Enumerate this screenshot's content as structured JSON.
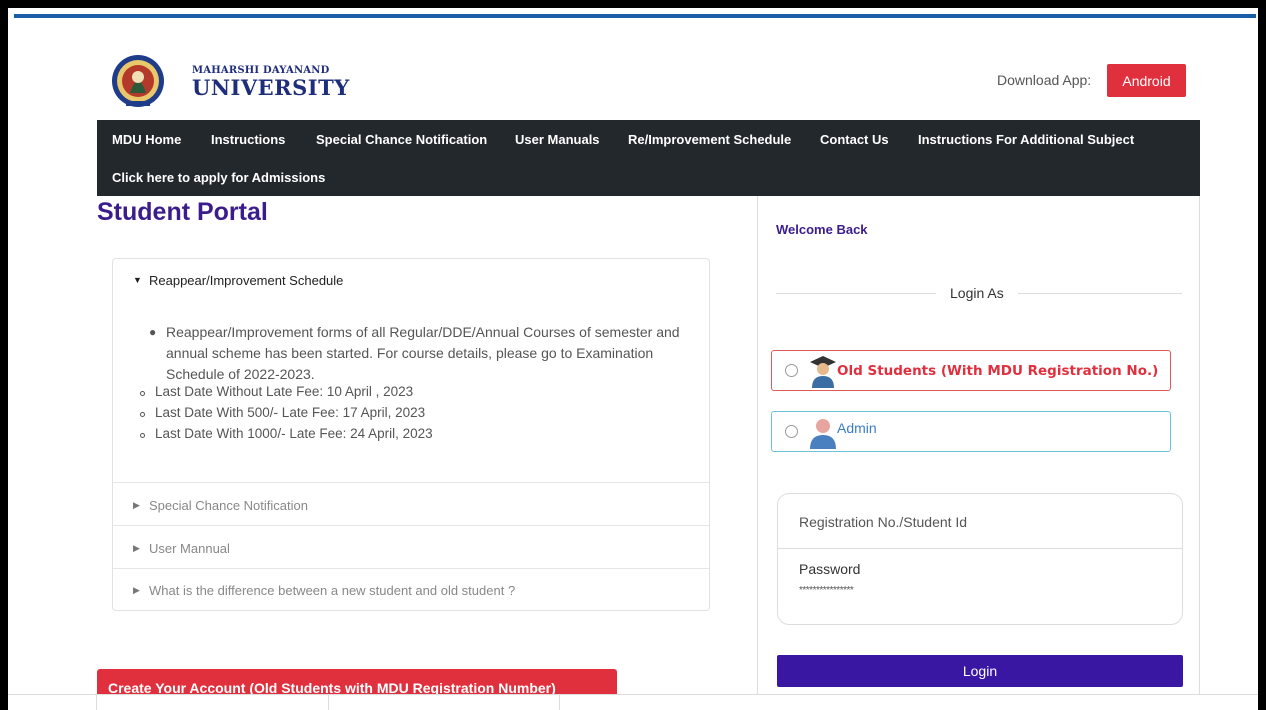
{
  "header": {
    "brand_line1": "MAHARSHI DAYANAND",
    "brand_line2": "UNIVERSITY",
    "download_label": "Download App:",
    "android_label": "Android"
  },
  "nav": {
    "items": [
      "MDU Home",
      "Instructions",
      "Special Chance Notification",
      "User Manuals",
      "Re/Improvement Schedule",
      "Contact Us",
      "Instructions For Additional Subject"
    ],
    "admissions": "Click here to apply for Admissions"
  },
  "portal": {
    "title": "Student Portal",
    "accordion": {
      "open_title": "Reappear/Improvement Schedule",
      "main_text": "Reappear/Improvement forms of all Regular/DDE/Annual Courses of semester and annual scheme has been started. For course details, please go to Examination Schedule of 2022-2023.",
      "dates": [
        "Last Date Without Late Fee: 10 April , 2023",
        "Last Date With 500/- Late Fee: 17 April, 2023",
        "Last Date With 1000/- Late Fee: 24 April, 2023"
      ],
      "collapsed": [
        "Special Chance Notification",
        "User Mannual",
        "What is the difference between a new student and old student ?"
      ]
    },
    "create_account": "Create Your Account (Old Students with MDU Registration Number)"
  },
  "login": {
    "welcome": "Welcome Back",
    "login_as": "Login As",
    "role_old": "Old Students (With MDU Registration No.)",
    "role_admin": "Admin",
    "reg_placeholder": "Registration No./Student Id",
    "password_label": "Password",
    "password_value": "****************",
    "login_button": "Login"
  },
  "colors": {
    "nav_bg": "#23282d",
    "accent_red": "#e0303e",
    "brand_purple": "#3b1c8c",
    "login_button": "#3a17a3"
  }
}
